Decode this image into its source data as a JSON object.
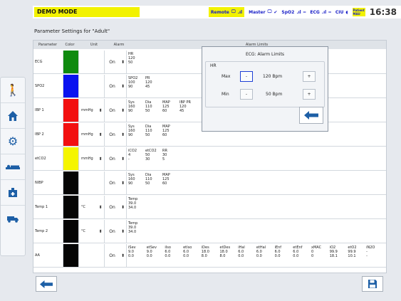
{
  "status": {
    "mode": "DEMO MODE",
    "remote": "Remote",
    "master": "Master",
    "spo2": "SpO2",
    "ecg": "ECG",
    "ciu": "CIU",
    "badge_line1": "Patient",
    "badge_line2": "MAU",
    "time": "16:38"
  },
  "page_title": "Parameter Settings for \"Adult\"",
  "table": {
    "col_parameter": "Parameter",
    "col_color": "Color",
    "col_unit": "Unit",
    "col_alarm": "Alarm",
    "col_limits": "Alarm Limits"
  },
  "colors": {
    "green": "#0f8a0f",
    "blue": "#0a12f0",
    "red": "#f21010",
    "yellow": "#f5f500",
    "black": "#050505"
  },
  "rows": [
    {
      "name": "ECG",
      "color": "#0f8a0f",
      "unit": "",
      "alarm": "On",
      "limits": [
        {
          "h": "HR",
          "v": [
            "120",
            "50"
          ]
        }
      ]
    },
    {
      "name": "SPO2",
      "color": "#0a12f0",
      "unit": "",
      "alarm": "On",
      "limits": [
        {
          "h": "SPO2",
          "v": [
            "100",
            "90"
          ]
        },
        {
          "h": "PR",
          "v": [
            "120",
            "45"
          ]
        }
      ]
    },
    {
      "name": "IBP 1",
      "color": "#f21010",
      "unit": "mmHg",
      "alarm": "On",
      "limits": [
        {
          "h": "Sys",
          "v": [
            "160",
            "90"
          ]
        },
        {
          "h": "Dia",
          "v": [
            "110",
            "50"
          ]
        },
        {
          "h": "MAP",
          "v": [
            "125",
            "60"
          ]
        },
        {
          "h": "IBP PR",
          "v": [
            "120",
            "45"
          ]
        }
      ]
    },
    {
      "name": "IBP 2",
      "color": "#f21010",
      "unit": "mmHg",
      "alarm": "On",
      "limits": [
        {
          "h": "Sys",
          "v": [
            "160",
            "90"
          ]
        },
        {
          "h": "Dia",
          "v": [
            "110",
            "50"
          ]
        },
        {
          "h": "MAP",
          "v": [
            "125",
            "60"
          ]
        }
      ]
    },
    {
      "name": "etCO2",
      "color": "#f5f500",
      "unit": "mmHg",
      "alarm": "On",
      "limits": [
        {
          "h": "iCO2",
          "v": [
            "4",
            "-"
          ]
        },
        {
          "h": "etCO2",
          "v": [
            "50",
            "30"
          ]
        },
        {
          "h": "RR",
          "v": [
            "30",
            "5"
          ]
        }
      ]
    },
    {
      "name": "NIBP",
      "color": "#050505",
      "unit": "",
      "alarm": "On",
      "limits": [
        {
          "h": "Sys",
          "v": [
            "160",
            "90"
          ]
        },
        {
          "h": "Dia",
          "v": [
            "110",
            "50"
          ]
        },
        {
          "h": "MAP",
          "v": [
            "125",
            "60"
          ]
        }
      ]
    },
    {
      "name": "Temp 1",
      "color": "#050505",
      "unit": "°C",
      "alarm": "On",
      "limits": [
        {
          "h": "Temp",
          "v": [
            "39.0",
            "34.0"
          ]
        }
      ]
    },
    {
      "name": "Temp 2",
      "color": "#050505",
      "unit": "°C",
      "alarm": "On",
      "limits": [
        {
          "h": "Temp",
          "v": [
            "39.0",
            "34.0"
          ]
        }
      ]
    },
    {
      "name": "AA",
      "color": "#050505",
      "unit": "",
      "alarm": "On",
      "limits": [
        {
          "h": "iSev",
          "v": [
            "9.0",
            "0.0"
          ]
        },
        {
          "h": "etSev",
          "v": [
            "9.0",
            "0.0"
          ]
        },
        {
          "h": "iIso",
          "v": [
            "6.0",
            "0.0"
          ]
        },
        {
          "h": "etIso",
          "v": [
            "6.0",
            "0.0"
          ]
        },
        {
          "h": "iDes",
          "v": [
            "18.0",
            "8.0"
          ]
        },
        {
          "h": "etDes",
          "v": [
            "18.0",
            "8.0"
          ]
        },
        {
          "h": "iHal",
          "v": [
            "6.0",
            "0.0"
          ]
        },
        {
          "h": "etHal",
          "v": [
            "6.0",
            "0.0"
          ]
        },
        {
          "h": "iEnf",
          "v": [
            "6.0",
            "0.0"
          ]
        },
        {
          "h": "etEnf",
          "v": [
            "6.0",
            "0.0"
          ]
        },
        {
          "h": "xMAC",
          "v": [
            "0",
            "0"
          ]
        },
        {
          "h": "iO2",
          "v": [
            "99.9",
            "18.1"
          ]
        },
        {
          "h": "etO2",
          "v": [
            "99.9",
            "10.1"
          ]
        },
        {
          "h": "iN2O",
          "v": [
            "-",
            "-"
          ]
        }
      ]
    }
  ],
  "popup": {
    "title": "ECG: Alarm Limits",
    "group": "HR",
    "max_label": "Max",
    "min_label": "Min",
    "max_value": "120 Bpm",
    "min_value": "50 Bpm",
    "minus": "-",
    "plus": "+"
  },
  "icons": {
    "back": "arrow-left-icon",
    "save": "floppy-disk-icon"
  }
}
